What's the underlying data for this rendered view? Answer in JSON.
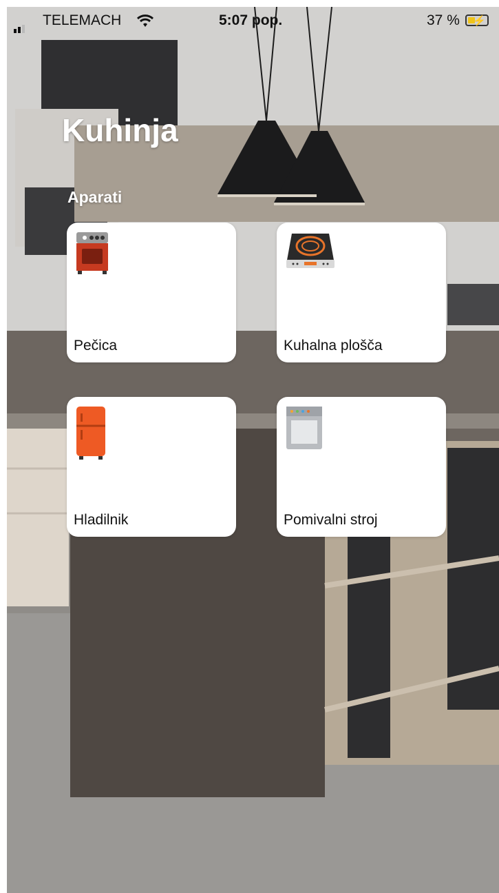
{
  "status_bar": {
    "carrier": "TELEMACH",
    "time": "5:07 pop.",
    "battery": "37 %",
    "battery_level": 0.37
  },
  "header": {
    "title": "Kuhinja",
    "section": "Aparati"
  },
  "appliances": [
    {
      "label": "Pečica",
      "icon": "oven-icon"
    },
    {
      "label": "Kuhalna plošča",
      "icon": "induction-cooktop-icon"
    },
    {
      "label": "Hladilnik",
      "icon": "fridge-icon"
    },
    {
      "label": "Pomivalni stroj",
      "icon": "dishwasher-icon"
    }
  ]
}
